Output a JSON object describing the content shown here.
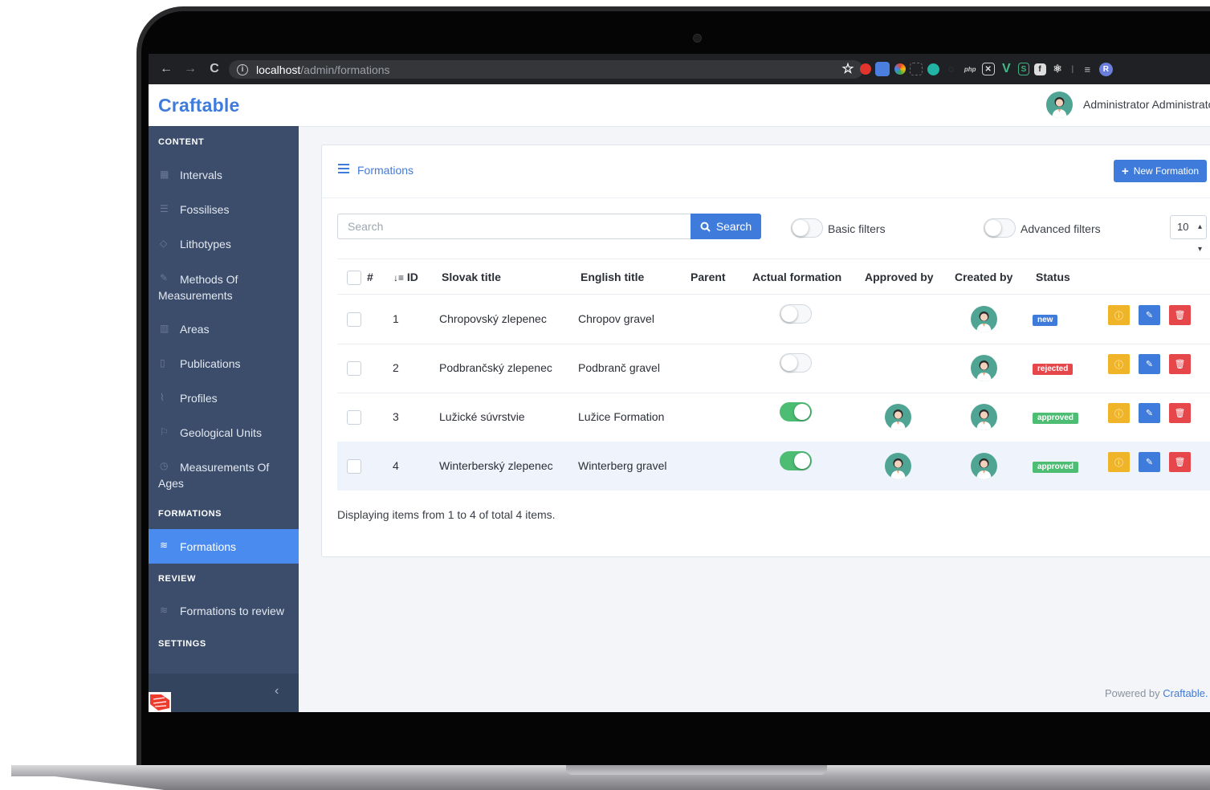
{
  "browser": {
    "url_host": "localhost",
    "url_path": "/admin/formations",
    "back": "←",
    "forward": "→",
    "reload": "C",
    "star": "☆",
    "profile_initial": "R"
  },
  "app": {
    "brand": "Craftable",
    "user_name": "Administrator Administrator"
  },
  "sidebar": {
    "sections": [
      {
        "title": "CONTENT"
      },
      {
        "title": "FORMATIONS"
      },
      {
        "title": "REVIEW"
      },
      {
        "title": "SETTINGS"
      }
    ],
    "items": [
      {
        "label": "Intervals",
        "icon": "calendar-icon"
      },
      {
        "label": "Fossilises",
        "icon": "list-icon"
      },
      {
        "label": "Lithotypes",
        "icon": "tag-icon"
      },
      {
        "label": "Methods Of Measurements",
        "icon": "pencil-icon"
      },
      {
        "label": "Areas",
        "icon": "map-icon"
      },
      {
        "label": "Publications",
        "icon": "document-icon"
      },
      {
        "label": "Profiles",
        "icon": "paperclip-icon"
      },
      {
        "label": "Geological Units",
        "icon": "flag-icon"
      },
      {
        "label": "Measurements Of Ages",
        "icon": "clock-icon"
      },
      {
        "label": "Formations",
        "icon": "layers-icon",
        "active": true
      },
      {
        "label": "Formations to review",
        "icon": "layers-icon"
      }
    ]
  },
  "card": {
    "title": "Formations",
    "new_button": "New Formation",
    "search_placeholder": "Search",
    "search_button": "Search",
    "basic_filters": "Basic filters",
    "advanced_filters": "Advanced filters",
    "per_page": "10"
  },
  "table": {
    "headers": [
      "#",
      "ID",
      "Slovak title",
      "English title",
      "Parent",
      "Actual formation",
      "Approved by",
      "Created by",
      "Status"
    ],
    "rows": [
      {
        "id": "1",
        "slovak": "Chropovský zlepenec",
        "english": "Chropov gravel",
        "parent": "",
        "actual": false,
        "approved": false,
        "status": "new"
      },
      {
        "id": "2",
        "slovak": "Podbrančský zlepenec",
        "english": "Podbranč gravel",
        "parent": "",
        "actual": false,
        "approved": false,
        "status": "rejected"
      },
      {
        "id": "3",
        "slovak": "Lužické súvrstvie",
        "english": "Lužice Formation",
        "parent": "",
        "actual": true,
        "approved": true,
        "status": "approved"
      },
      {
        "id": "4",
        "slovak": "Winterberský zlepenec",
        "english": "Winterberg gravel",
        "parent": "",
        "actual": true,
        "approved": true,
        "status": "approved"
      }
    ],
    "footer": "Displaying items from 1 to 4 of total 4 items."
  },
  "status_colors": {
    "new": "#3f7bdb",
    "rejected": "#e5474b",
    "approved": "#4dbd74"
  },
  "powered_by_prefix": "Powered by",
  "powered_by_link": "Craftable."
}
